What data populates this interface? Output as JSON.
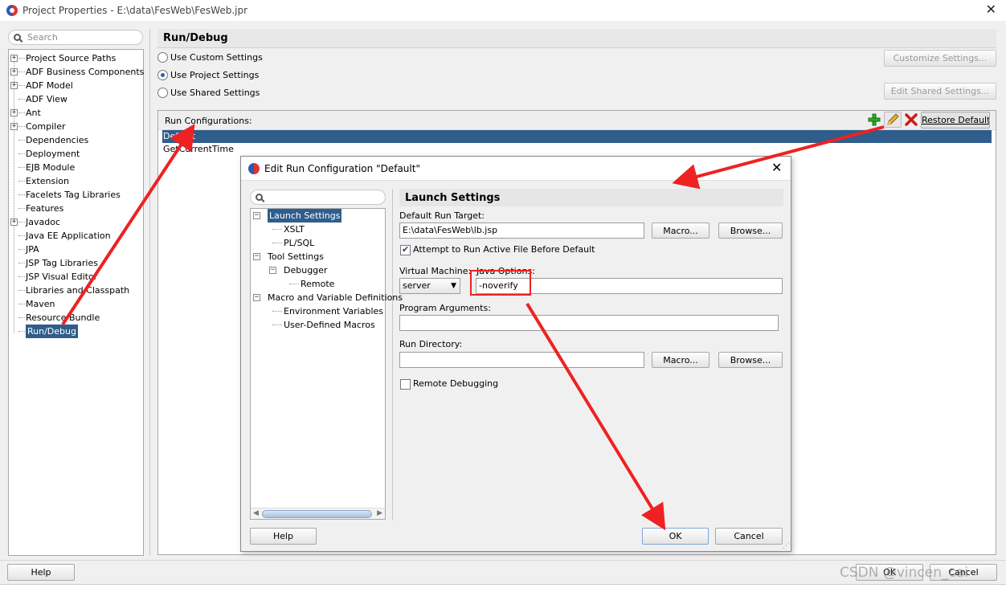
{
  "window": {
    "title": "Project Properties - E:\\data\\FesWeb\\FesWeb.jpr",
    "close": "✕"
  },
  "sidebar": {
    "search_placeholder": "Search",
    "items": [
      {
        "label": "Project Source Paths",
        "expandable": true
      },
      {
        "label": "ADF Business Components",
        "expandable": true
      },
      {
        "label": "ADF Model",
        "expandable": true
      },
      {
        "label": "ADF View",
        "expandable": false
      },
      {
        "label": "Ant",
        "expandable": true
      },
      {
        "label": "Compiler",
        "expandable": true
      },
      {
        "label": "Dependencies",
        "expandable": false
      },
      {
        "label": "Deployment",
        "expandable": false
      },
      {
        "label": "EJB Module",
        "expandable": false
      },
      {
        "label": "Extension",
        "expandable": false
      },
      {
        "label": "Facelets Tag Libraries",
        "expandable": false
      },
      {
        "label": "Features",
        "expandable": false
      },
      {
        "label": "Javadoc",
        "expandable": true
      },
      {
        "label": "Java EE Application",
        "expandable": false
      },
      {
        "label": "JPA",
        "expandable": false
      },
      {
        "label": "JSP Tag Libraries",
        "expandable": false
      },
      {
        "label": "JSP Visual Editor",
        "expandable": false
      },
      {
        "label": "Libraries and Classpath",
        "expandable": false
      },
      {
        "label": "Maven",
        "expandable": false
      },
      {
        "label": "Resource Bundle",
        "expandable": false
      },
      {
        "label": "Run/Debug",
        "expandable": false,
        "selected": true
      }
    ]
  },
  "main": {
    "heading": "Run/Debug",
    "options": [
      {
        "label": "Use Custom Settings",
        "checked": false
      },
      {
        "label": "Use Project Settings",
        "checked": true
      },
      {
        "label": "Use Shared Settings",
        "checked": false
      }
    ],
    "customize_button": "Customize Settings...",
    "edit_shared_button": "Edit Shared Settings...",
    "run_configs_label": "Run Configurations:",
    "restore_defaults": "Restore Defaults",
    "configs": [
      {
        "label": "Default",
        "selected": true
      },
      {
        "label": "GetCurrentTime",
        "selected": false
      }
    ]
  },
  "dialog": {
    "title": "Edit Run Configuration \"Default\"",
    "close": "✕",
    "tree": [
      {
        "label": "Launch Settings",
        "level": 0,
        "expandable": true,
        "selected": true
      },
      {
        "label": "XSLT",
        "level": 1
      },
      {
        "label": "PL/SQL",
        "level": 1
      },
      {
        "label": "Tool Settings",
        "level": 0,
        "expandable": true
      },
      {
        "label": "Debugger",
        "level": 1,
        "expandable": true
      },
      {
        "label": "Remote",
        "level": 2
      },
      {
        "label": "Macro and Variable Definitions",
        "level": 0,
        "expandable": true
      },
      {
        "label": "Environment Variables",
        "level": 1
      },
      {
        "label": "User-Defined Macros",
        "level": 1
      }
    ],
    "section_title": "Launch Settings",
    "default_run_target_label": "Default Run Target:",
    "default_run_target_value": "E:\\data\\FesWeb\\lb.jsp",
    "macro_button": "Macro...",
    "browse_button": "Browse...",
    "attempt_label": "Attempt to Run Active File Before Default",
    "attempt_checked": true,
    "vm_label": "Virtual Machine:",
    "vm_value": "server",
    "java_options_label": "Java Options:",
    "java_options_value": "-noverify",
    "program_args_label": "Program Arguments:",
    "program_args_value": "",
    "run_dir_label": "Run Directory:",
    "run_dir_value": "",
    "remote_debugging_label": "Remote Debugging",
    "remote_debugging_checked": false,
    "help": "Help",
    "ok": "OK",
    "cancel": "Cancel"
  },
  "footer": {
    "help": "Help",
    "ok": "OK",
    "cancel": "Cancel"
  },
  "watermark": "CSDN @vincen_cai",
  "colors": {
    "selection": "#2f5d8c",
    "annotation_red": "#e22222"
  }
}
